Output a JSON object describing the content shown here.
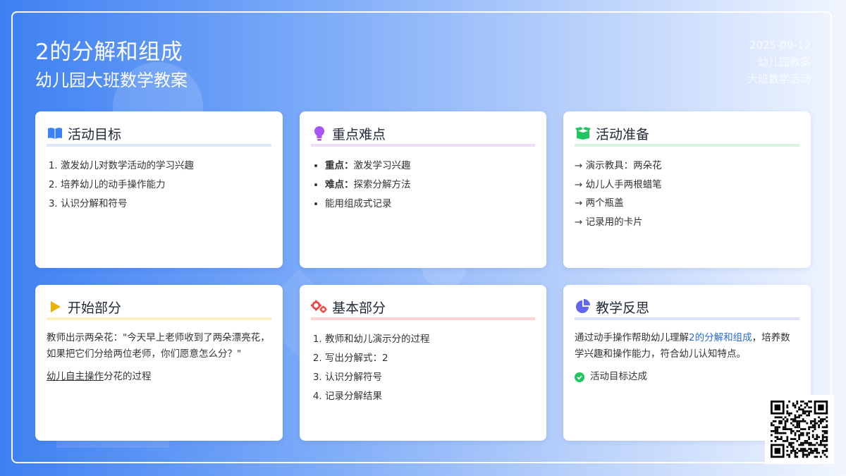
{
  "header": {
    "title": "2的分解和组成",
    "subtitle": "幼儿园大班数学教案",
    "date": "2025-09-12",
    "tag1": "幼儿园教案",
    "tag2": "大班数学活动"
  },
  "colors": {
    "goal": "#3b82f6",
    "key": "#a855f7",
    "prep": "#22c55e",
    "start": "#eab308",
    "basic": "#ef4444",
    "reflect": "#6366f1"
  },
  "cards": {
    "goals": {
      "icon": "open-book-icon",
      "title": "活动目标",
      "items": [
        "激发幼儿对数学活动的学习兴趣",
        "培养幼儿的动手操作能力",
        "认识分解和符号"
      ]
    },
    "key_points": {
      "icon": "lightbulb-icon",
      "title": "重点难点",
      "items": [
        {
          "label": "重点：",
          "text": "激发学习兴趣"
        },
        {
          "label": "难点：",
          "text": "探索分解方法"
        },
        {
          "label": "",
          "text": "能用组成式记录"
        }
      ]
    },
    "prep": {
      "icon": "box-icon",
      "title": "活动准备",
      "items": [
        "→ 演示教具：两朵花",
        "→ 幼儿人手两根蜡笔",
        "→ 两个瓶盖",
        "→ 记录用的卡片"
      ]
    },
    "start": {
      "icon": "play-icon",
      "title": "开始部分",
      "paragraph": "教师出示两朵花：\"今天早上老师收到了两朵漂亮花，如果把它们分给两位老师，你们愿意怎么分？\"",
      "underline_text": "幼儿自主操作",
      "tail_text": "分花的过程"
    },
    "basic": {
      "icon": "gears-icon",
      "title": "基本部分",
      "items": [
        "教师和幼儿演示分的过程",
        "写出分解式：2",
        "认识分解符号",
        "记录分解结果"
      ]
    },
    "reflect": {
      "icon": "pie-chart-icon",
      "title": "教学反思",
      "text_before": "通过动手操作帮助幼儿理解",
      "highlight": "2的分解和组成",
      "text_after": "，培养数学兴趣和操作能力，符合幼儿认知特点。",
      "check": "活动目标达成"
    }
  },
  "qr_code": "qr-code-icon"
}
